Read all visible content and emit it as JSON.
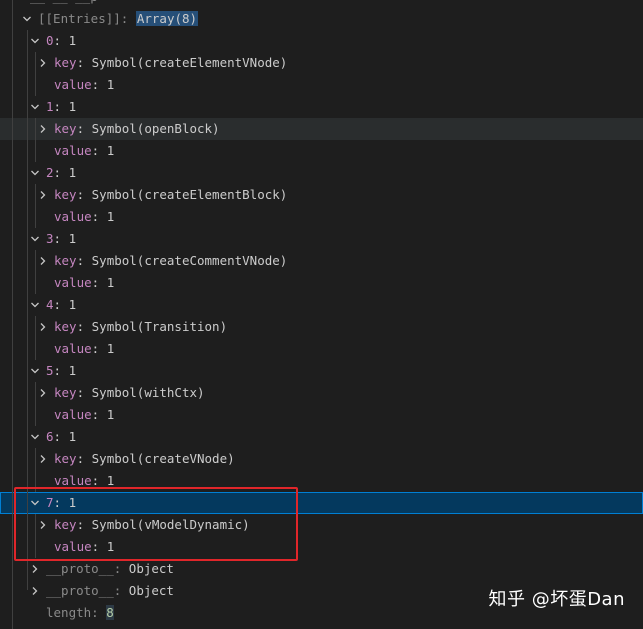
{
  "header_fragment": "__ __ __p",
  "entries": {
    "label": "[[Entries]]",
    "colon": ":",
    "value": "Array(8)"
  },
  "items": [
    {
      "index": "0",
      "count": "1",
      "key_label": "key",
      "key_value": "Symbol(createElementVNode)",
      "value_label": "value",
      "value": "1"
    },
    {
      "index": "1",
      "count": "1",
      "key_label": "key",
      "key_value": "Symbol(openBlock)",
      "value_label": "value",
      "value": "1"
    },
    {
      "index": "2",
      "count": "1",
      "key_label": "key",
      "key_value": "Symbol(createElementBlock)",
      "value_label": "value",
      "value": "1"
    },
    {
      "index": "3",
      "count": "1",
      "key_label": "key",
      "key_value": "Symbol(createCommentVNode)",
      "value_label": "value",
      "value": "1"
    },
    {
      "index": "4",
      "count": "1",
      "key_label": "key",
      "key_value": "Symbol(Transition)",
      "value_label": "value",
      "value": "1"
    },
    {
      "index": "5",
      "count": "1",
      "key_label": "key",
      "key_value": "Symbol(withCtx)",
      "value_label": "value",
      "value": "1"
    },
    {
      "index": "6",
      "count": "1",
      "key_label": "key",
      "key_value": "Symbol(createVNode)",
      "value_label": "value",
      "value": "1"
    },
    {
      "index": "7",
      "count": "1",
      "key_label": "key",
      "key_value": "Symbol(vModelDynamic)",
      "value_label": "value",
      "value": "1"
    }
  ],
  "protos": [
    {
      "label": "__proto__",
      "value": "Object"
    },
    {
      "label": "__proto__",
      "value": "Object"
    }
  ],
  "length": {
    "label": "length",
    "value": "8"
  },
  "watermark": "知乎 @坏蛋Dan",
  "colors": {
    "background": "#1e1e1e",
    "property_name": "#c586c0",
    "number": "#b5cea8",
    "selected_row": "#04395e",
    "highlight_box": "#e0262a"
  }
}
